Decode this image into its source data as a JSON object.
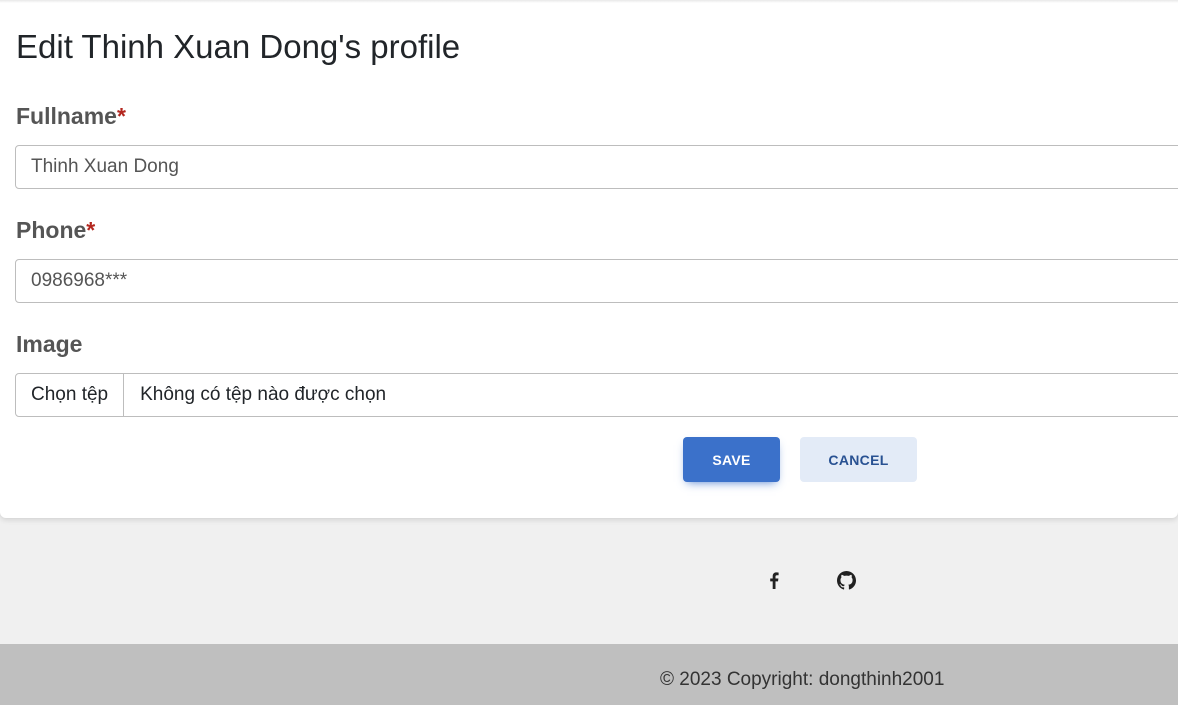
{
  "title": "Edit Thinh Xuan Dong's profile",
  "form": {
    "fullname": {
      "label": "Fullname",
      "required_mark": "*",
      "value": "Thinh Xuan Dong"
    },
    "phone": {
      "label": "Phone",
      "required_mark": "*",
      "value": "0986968***"
    },
    "image": {
      "label": "Image",
      "choose_button": "Chọn tệp",
      "status": "Không có tệp nào được chọn"
    },
    "save_label": "SAVE",
    "cancel_label": "CANCEL"
  },
  "social": [
    {
      "icon": "facebook-icon"
    },
    {
      "icon": "github-icon"
    }
  ],
  "footer": {
    "copyright_prefix": "© 2023 Copyright: ",
    "copyright_link": "dongthinh2001"
  },
  "colors": {
    "primary": "#3b71ca",
    "required": "#b3261e",
    "footer_bg": "#bfbfbf",
    "page_bg": "#f0f0f0"
  }
}
